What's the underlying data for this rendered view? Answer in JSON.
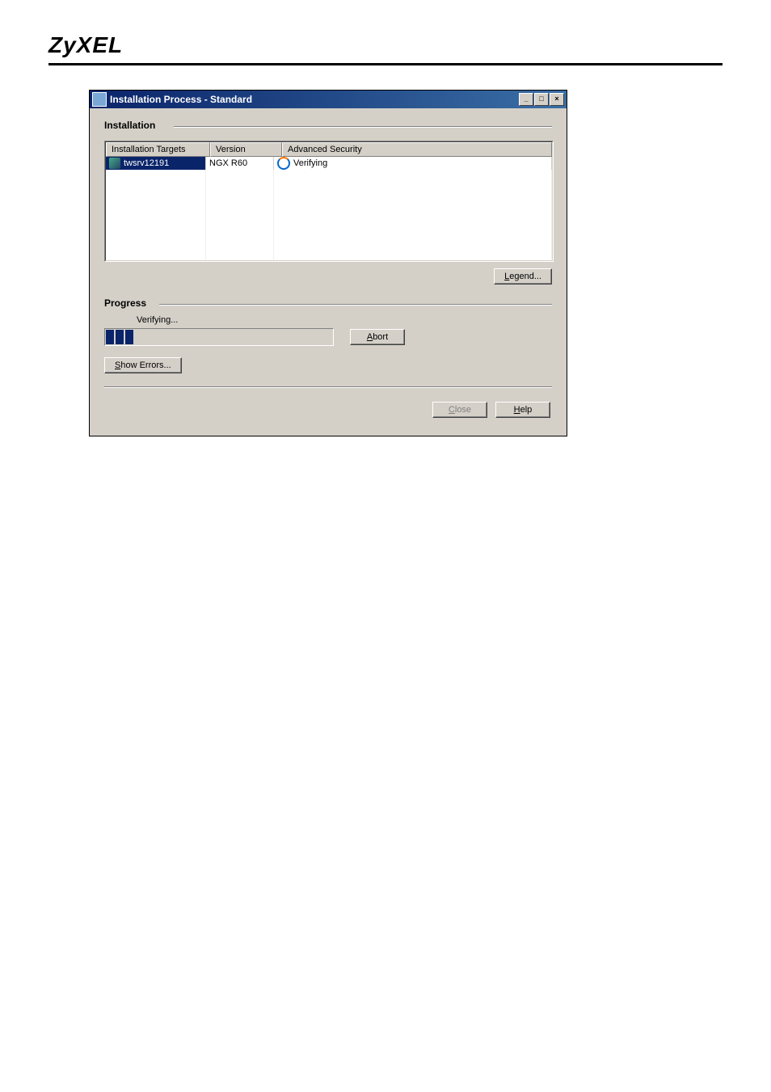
{
  "brand": "ZyXEL",
  "window": {
    "title": "Installation Process  - Standard"
  },
  "installation": {
    "title": "Installation",
    "columns": {
      "targets": "Installation Targets",
      "version": "Version",
      "advsec": "Advanced Security"
    },
    "row": {
      "target": "twsrv12191",
      "version": "NGX R60",
      "status": "Verifying"
    },
    "legend_btn": "Legend..."
  },
  "progress": {
    "title": "Progress",
    "label": "Verifying...",
    "abort_btn": "Abort",
    "show_errors_btn": "Show Errors..."
  },
  "buttons": {
    "close": "Close",
    "help": "Help"
  }
}
